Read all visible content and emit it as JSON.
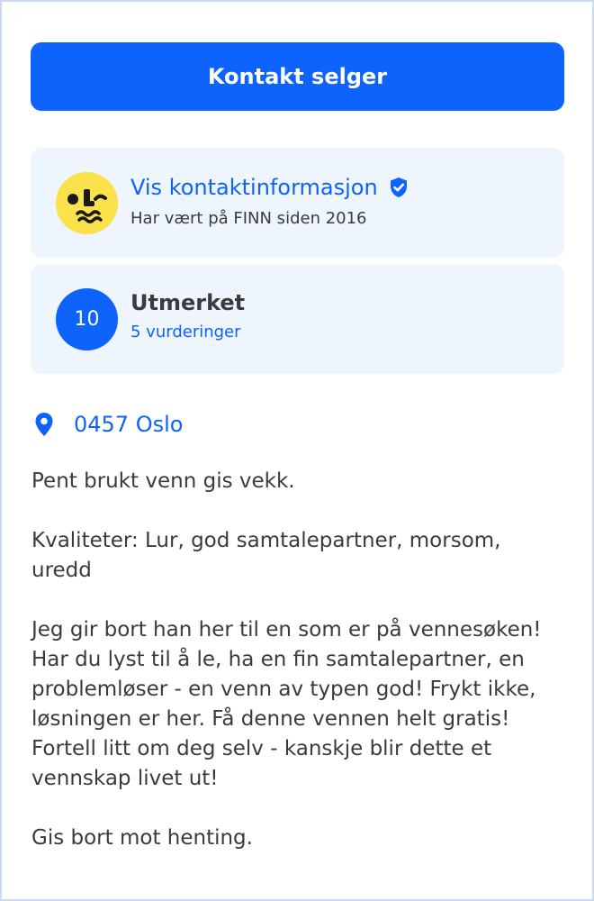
{
  "contact_button": {
    "label": "Kontakt selger"
  },
  "seller": {
    "name_link": "Vis kontaktinformasjon",
    "member_since": "Har vært på FINN siden 2016",
    "avatar_icon": "smiley-face-avatar",
    "verified_icon": "verified-shield-icon"
  },
  "rating": {
    "score": "10",
    "label": "Utmerket",
    "count": "5 vurderinger"
  },
  "location": {
    "icon": "map-pin-icon",
    "text": "0457 Oslo"
  },
  "description": {
    "p1": "Pent brukt venn gis vekk.",
    "p2_line1": "Kvaliteter: Lur, god samtalepartner, morsom,",
    "p2_line2": "uredd",
    "p3_line1": "Jeg gir bort han her til en som er på vennesøken!",
    "p3_line2": "Har du lyst til å le, ha en fin samtalepartner, en",
    "p3_line3": "problemløser - en venn av typen god! Frykt ikke,",
    "p3_line4": "løsningen er her. Få denne vennen helt gratis!",
    "p3_line5": "Fortell litt om deg selv - kanskje blir dette et",
    "p3_line6": "vennskap livet ut!",
    "p4": "Gis bort mot henting."
  },
  "colors": {
    "accent": "#0d63fb",
    "card_background": "#eef5fd",
    "avatar_yellow": "#fbe24a",
    "text": "#3b3b3f"
  }
}
